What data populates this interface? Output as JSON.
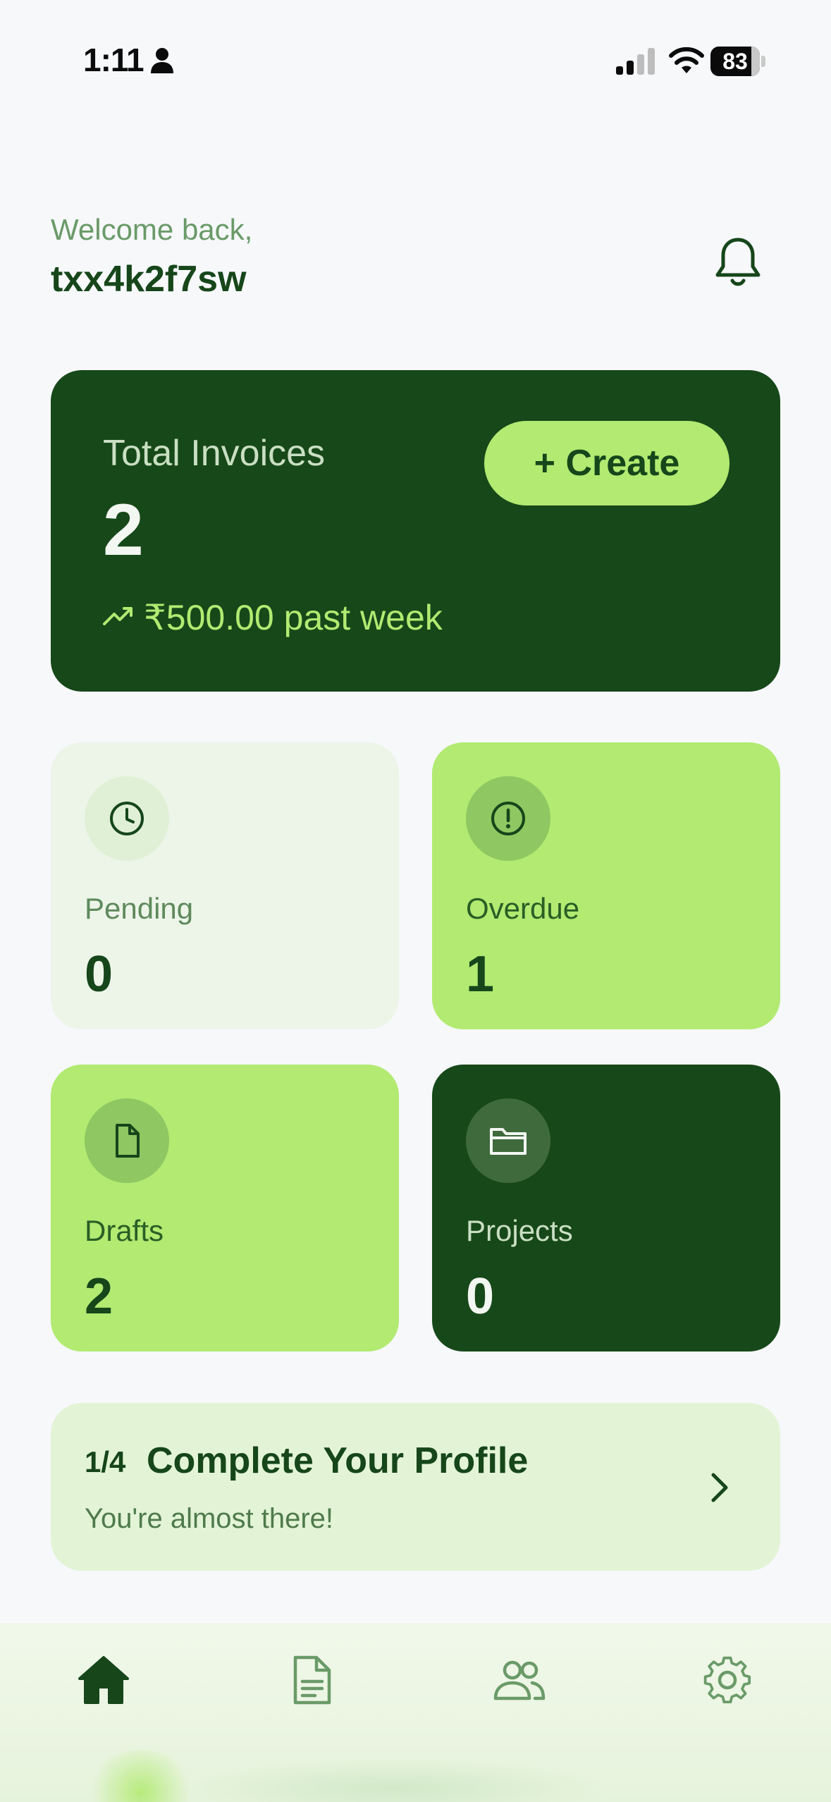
{
  "status_bar": {
    "time": "1:11",
    "battery": "83"
  },
  "header": {
    "welcome": "Welcome back,",
    "username": "txx4k2f7sw"
  },
  "summary": {
    "label": "Total Invoices",
    "value": "2",
    "create_label": "+ Create",
    "trend_text": "₹500.00 past week"
  },
  "stats": {
    "pending": {
      "label": "Pending",
      "value": "0",
      "icon": "clock-icon"
    },
    "overdue": {
      "label": "Overdue",
      "value": "1",
      "icon": "alert-circle-icon"
    },
    "drafts": {
      "label": "Drafts",
      "value": "2",
      "icon": "file-icon"
    },
    "projects": {
      "label": "Projects",
      "value": "0",
      "icon": "folder-icon"
    }
  },
  "profile": {
    "step": "1/4",
    "title": "Complete Your Profile",
    "subtitle": "You're almost there!"
  },
  "nav": {
    "items": [
      "home-icon",
      "invoice-icon",
      "users-icon",
      "settings-icon"
    ]
  },
  "colors": {
    "dark_green": "#174819",
    "lime": "#b2ea72",
    "background": "#f6f8fa"
  }
}
